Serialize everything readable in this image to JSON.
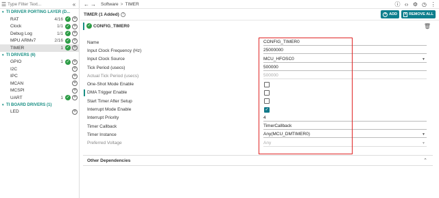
{
  "sidebar": {
    "filter_placeholder": "Type Filter Text...",
    "groups": [
      {
        "title": "TI DRIVER PORTING LAYER (D...",
        "items": [
          {
            "label": "RAT",
            "count": "4/16",
            "status": "check"
          },
          {
            "label": "Clock",
            "count": "1/1",
            "status": "check"
          },
          {
            "label": "Debug Log",
            "count": "1/1",
            "status": "check"
          },
          {
            "label": "MPU ARMv7",
            "count": "2/16",
            "status": "check"
          },
          {
            "label": "TIMER",
            "count": "1",
            "status": "check",
            "selected": true
          }
        ]
      },
      {
        "title": "TI DRIVERS (6)",
        "items": [
          {
            "label": "GPIO",
            "count": "1",
            "status": "check"
          },
          {
            "label": "I2C",
            "count": "",
            "status": ""
          },
          {
            "label": "IPC",
            "count": "",
            "status": ""
          },
          {
            "label": "MCAN",
            "count": "",
            "status": ""
          },
          {
            "label": "MCSPI",
            "count": "",
            "status": ""
          },
          {
            "label": "UART",
            "count": "1",
            "status": "check"
          }
        ]
      },
      {
        "title": "TI BOARD DRIVERS (1)",
        "items": [
          {
            "label": "LED",
            "count": "",
            "status": ""
          }
        ]
      }
    ]
  },
  "topbar": {
    "breadcrumb": [
      "Software",
      "TIMER"
    ],
    "separator": ">"
  },
  "header": {
    "title": "TIMER (1 Added)",
    "add_label": "ADD",
    "remove_all_label": "REMOVE ALL"
  },
  "config": {
    "name": "CONFIG_TIMER0"
  },
  "fields": [
    {
      "label": "Name",
      "type": "text",
      "value": "CONFIG_TIMER0"
    },
    {
      "label": "Input Clock Frequency (Hz)",
      "type": "text",
      "value": "25000000"
    },
    {
      "label": "Input Clock Source",
      "type": "select",
      "value": "MCU_HFOSC0"
    },
    {
      "label": "Tick Period (usecs)",
      "type": "text",
      "value": "500000"
    },
    {
      "label": "Actual Tick Period (usecs)",
      "type": "text",
      "value": "500000",
      "disabled": true
    },
    {
      "label": "One-Shot Mode Enable",
      "type": "checkbox",
      "checked": false
    },
    {
      "label": "DMA Trigger Enable",
      "type": "checkbox",
      "checked": false,
      "marked": true
    },
    {
      "label": "Start Timer After Setup",
      "type": "checkbox",
      "checked": false
    },
    {
      "label": "Interrupt Mode Enable",
      "type": "checkbox",
      "checked": true
    },
    {
      "label": "Interrupt Priority",
      "type": "text",
      "value": "4"
    },
    {
      "label": "Timer Callback",
      "type": "text",
      "value": "TimerCallback"
    },
    {
      "label": "Timer Instance",
      "type": "select",
      "value": "Any(MCU_DMTIMER0)"
    },
    {
      "label": "Preferred Voltage",
      "type": "select",
      "value": "Any",
      "disabled": true
    }
  ],
  "other_dependencies": "Other Dependencies",
  "colors": {
    "accent": "#198f84",
    "button": "#0f7f8e",
    "check_green": "#2d9c46",
    "highlight_box": "#e02424"
  }
}
